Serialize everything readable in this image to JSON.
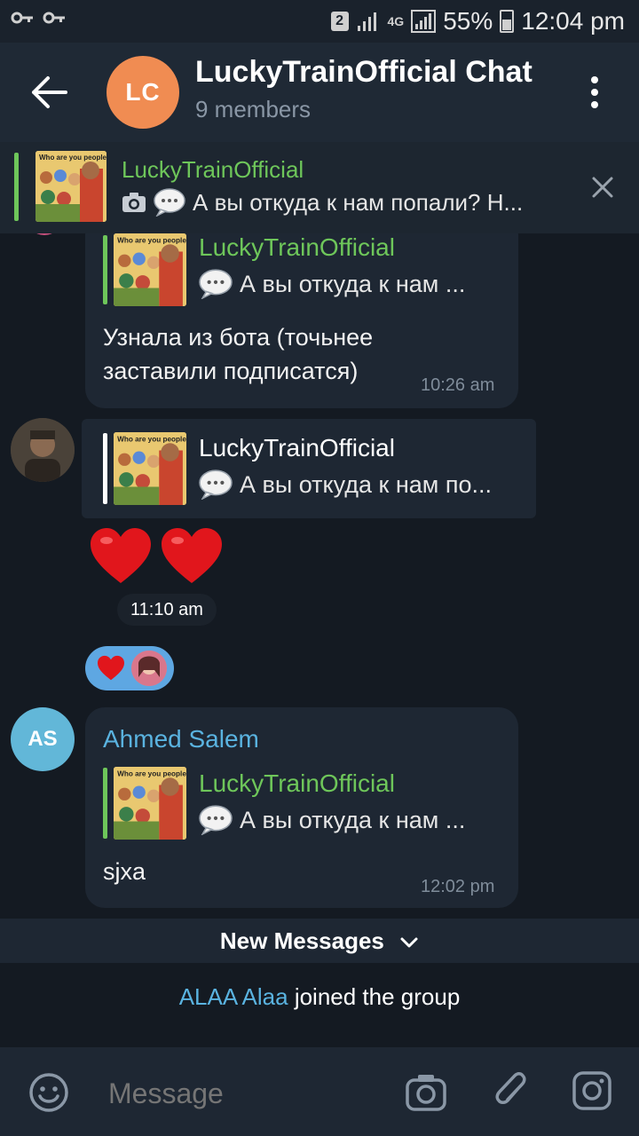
{
  "status_bar": {
    "sim": "2",
    "network": "4G",
    "battery": "55%",
    "time": "12:04 pm"
  },
  "header": {
    "avatar_initials": "LC",
    "title": "LuckyTrainOfficial Chat",
    "subtitle": "9 members"
  },
  "pinned": {
    "name": "LuckyTrainOfficial",
    "text": "А вы откуда к нам попали? Н...",
    "thumb_caption": "Who are you people?"
  },
  "messages": [
    {
      "reply_name": "LuckyTrainOfficial",
      "reply_text": "А вы откуда к нам ...",
      "text_line1": "Узнала из бота (точьнее",
      "text_line2": "заставили подписатся)",
      "time": "10:26 am"
    },
    {
      "reply_name": "LuckyTrainOfficial",
      "reply_text": "А вы откуда к нам по...",
      "hearts": "❤️❤️",
      "time": "11:10 am"
    },
    {
      "sender": "Ahmed Salem",
      "sender_initials": "AS",
      "reply_name": "LuckyTrainOfficial",
      "reply_text": "А вы откуда к нам ...",
      "text": "sjxa",
      "time": "12:02 pm"
    }
  ],
  "new_messages_label": "New Messages",
  "service": {
    "user": "ALAA Alaa",
    "action": "joined the group"
  },
  "input": {
    "placeholder": "Message"
  },
  "colors": {
    "accent_green": "#6ec65a",
    "avatar_lc": "#f08c52",
    "avatar_as": "#62b7d8",
    "link_blue": "#5ab3e0"
  }
}
